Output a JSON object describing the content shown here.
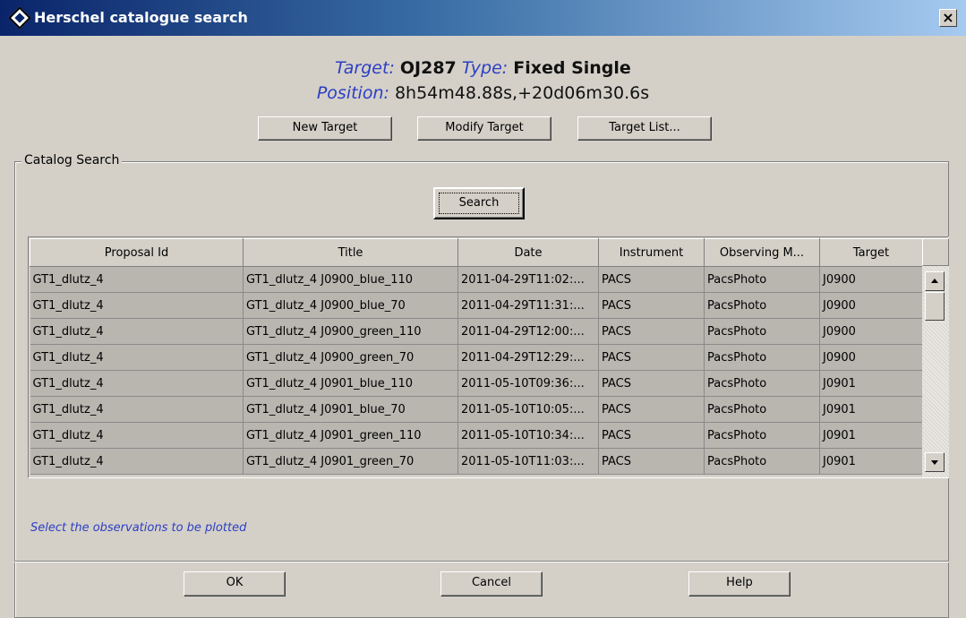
{
  "window": {
    "title": "Herschel catalogue search",
    "close_label": "×"
  },
  "target": {
    "target_label": "Target:",
    "target_value": "OJ287",
    "type_label": "Type:",
    "type_value": "Fixed Single",
    "position_label": "Position:",
    "position_value": "8h54m48.88s,+20d06m30.6s"
  },
  "target_buttons": {
    "new_target": "New Target",
    "modify_target": "Modify Target",
    "target_list": "Target List..."
  },
  "catalog": {
    "group_label": "Catalog Search",
    "search_label": "Search"
  },
  "table": {
    "columns": [
      "Proposal Id",
      "Title",
      "Date",
      "Instrument",
      "Observing M...",
      "Target"
    ],
    "rows": [
      [
        "GT1_dlutz_4",
        "GT1_dlutz_4 J0900_blue_110",
        "2011-04-29T11:02:...",
        "PACS",
        "PacsPhoto",
        "J0900"
      ],
      [
        "GT1_dlutz_4",
        "GT1_dlutz_4 J0900_blue_70",
        "2011-04-29T11:31:...",
        "PACS",
        "PacsPhoto",
        "J0900"
      ],
      [
        "GT1_dlutz_4",
        "GT1_dlutz_4 J0900_green_110",
        "2011-04-29T12:00:...",
        "PACS",
        "PacsPhoto",
        "J0900"
      ],
      [
        "GT1_dlutz_4",
        "GT1_dlutz_4 J0900_green_70",
        "2011-04-29T12:29:...",
        "PACS",
        "PacsPhoto",
        "J0900"
      ],
      [
        "GT1_dlutz_4",
        "GT1_dlutz_4 J0901_blue_110",
        "2011-05-10T09:36:...",
        "PACS",
        "PacsPhoto",
        "J0901"
      ],
      [
        "GT1_dlutz_4",
        "GT1_dlutz_4 J0901_blue_70",
        "2011-05-10T10:05:...",
        "PACS",
        "PacsPhoto",
        "J0901"
      ],
      [
        "GT1_dlutz_4",
        "GT1_dlutz_4 J0901_green_110",
        "2011-05-10T10:34:...",
        "PACS",
        "PacsPhoto",
        "J0901"
      ],
      [
        "GT1_dlutz_4",
        "GT1_dlutz_4 J0901_green_70",
        "2011-05-10T11:03:...",
        "PACS",
        "PacsPhoto",
        "J0901"
      ]
    ]
  },
  "status": {
    "message": "Select the observations to be plotted"
  },
  "dialog_buttons": {
    "ok": "OK",
    "cancel": "Cancel",
    "help": "Help"
  },
  "colors": {
    "titlebar_start": "#0a246a",
    "label_blue": "#2c3ec4",
    "window_bg": "#d4d0c8",
    "row_bg": "#b9b6b0"
  },
  "icons": [
    "app-icon",
    "close-icon",
    "scroll-up-icon",
    "scroll-down-icon"
  ]
}
